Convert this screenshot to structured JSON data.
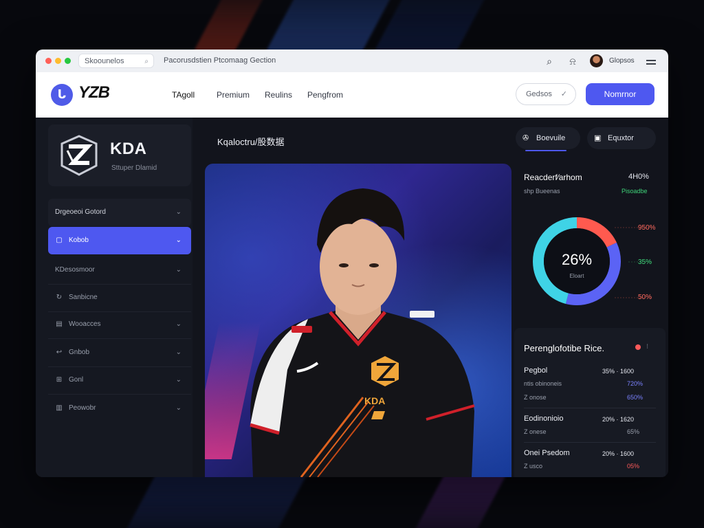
{
  "browser": {
    "tab_field": "Skoounelos",
    "url_text": "Pacorusdstien Ptcomaag Gection",
    "user_name": "Glopsos"
  },
  "header": {
    "logo_text": "YZB",
    "nav": [
      "TAgoll",
      "Premium",
      "Reulins",
      "Pengfrom"
    ],
    "outline_button": "Gedsos",
    "primary_button": "Nomrnor"
  },
  "sidebar": {
    "team_name": "KDA",
    "team_sub": "Sttuper Dlamid",
    "items": [
      {
        "label": "Drgeoeoi Gotord",
        "icon": "",
        "state": "group"
      },
      {
        "label": "Kobob",
        "icon": "▢",
        "state": "active"
      },
      {
        "label": "KDesosmoor",
        "icon": "",
        "state": "normal"
      },
      {
        "label": "Sanbicne",
        "icon": "↻",
        "state": "normal"
      },
      {
        "label": "Wooacces",
        "icon": "▤",
        "state": "normal"
      },
      {
        "label": "Gnbob",
        "icon": "↩",
        "state": "normal"
      },
      {
        "label": "Gonl",
        "icon": "⊞",
        "state": "normal"
      },
      {
        "label": "Peowobr",
        "icon": "▥",
        "state": "normal"
      }
    ]
  },
  "main": {
    "title": "Kqaloctru/股数据",
    "jersey_brand": "KDA"
  },
  "right": {
    "tabs": [
      "Boevuile",
      "Equxtor"
    ],
    "title": "Reacderf⁄arhom",
    "title_value": "4H0%",
    "subtitle": "shp Bueenas",
    "subtitle_value": "Pisoadbe",
    "donut": {
      "center_value": "26%",
      "center_label": "Eloart",
      "segments": [
        {
          "label": "red",
          "value": 18,
          "color": "#ff5a4f"
        },
        {
          "label": "blue",
          "value": 36,
          "color": "#5b63f5"
        },
        {
          "label": "cyan",
          "value": 46,
          "color": "#3fd3e6"
        }
      ],
      "legend": [
        {
          "pct": "950%",
          "color": "#ff6a5f"
        },
        {
          "pct": "35%",
          "color": "#3fd67a"
        },
        {
          "pct": "50%",
          "color": "#ff6a5f"
        }
      ]
    },
    "stats": {
      "title": "Perenglofotibe Rice.",
      "rows": [
        {
          "name": "Pegbol",
          "nums": "35% · 1600",
          "sub": "ntis obinoneis",
          "right1": "720%",
          "sub2": "Z onose",
          "right2": "650%",
          "right_color": "#7b82ff"
        },
        {
          "name": "Eodinonioio",
          "nums": "20% · 1620",
          "sub": "Z onese",
          "right1": "",
          "sub2": "",
          "right2": "65%",
          "right_color": "#9aa0ad"
        },
        {
          "name": "Onei Psedom",
          "nums": "20% · 1600",
          "sub": "Z usco",
          "right1": "",
          "sub2": "",
          "right2": "05%",
          "right_color": "#ff5a5a"
        }
      ]
    }
  }
}
